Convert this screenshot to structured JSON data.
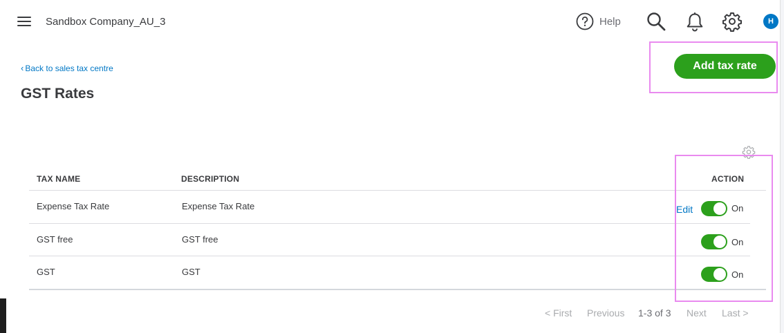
{
  "header": {
    "company_name": "Sandbox Company_AU_3",
    "help_label": "Help",
    "avatar_initial": "H"
  },
  "page": {
    "back_link": "Back to sales tax centre",
    "title": "GST Rates",
    "add_button": "Add tax rate"
  },
  "table": {
    "columns": [
      "TAX NAME",
      "DESCRIPTION",
      "ACTION"
    ],
    "rows": [
      {
        "tax_name": "Expense Tax Rate",
        "description": "Expense Tax Rate",
        "edit": "Edit",
        "status": "On"
      },
      {
        "tax_name": "GST free",
        "description": "GST free",
        "status": "On"
      },
      {
        "tax_name": "GST",
        "description": "GST",
        "status": "On"
      }
    ]
  },
  "pagination": {
    "first": "< First",
    "previous": "Previous",
    "range": "1-3 of 3",
    "next": "Next",
    "last": "Last >"
  },
  "colors": {
    "accent_green": "#2ca01c",
    "link_blue": "#0077c5",
    "highlight": "#e98aef"
  }
}
